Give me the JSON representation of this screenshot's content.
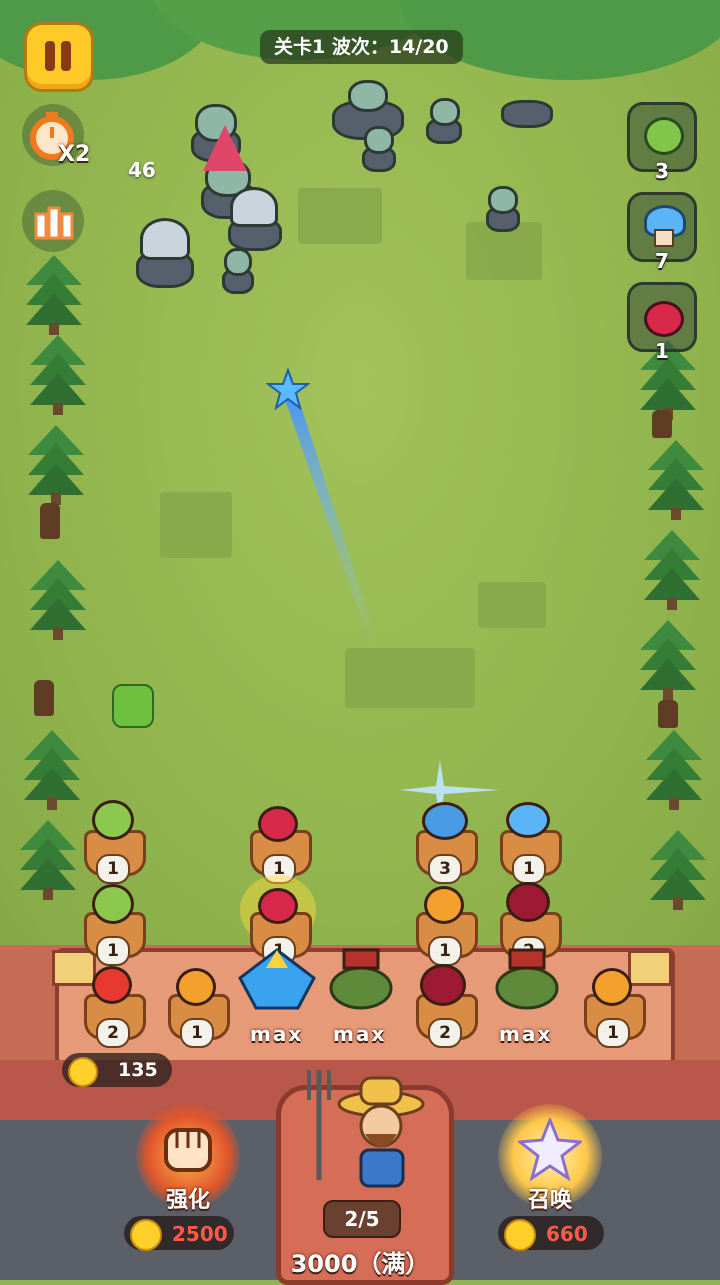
{
  "hud": {
    "level_title": "关卡1 波次：14/20",
    "speed_label": "X2",
    "damage_popup": "46"
  },
  "enemy_queue": [
    {
      "type": "green-peashooter",
      "count": "3"
    },
    {
      "type": "blue-mushroom",
      "count": "7"
    },
    {
      "type": "red-cherry-bomb",
      "count": "1"
    }
  ],
  "plants": [
    {
      "kind": "peashooter",
      "level": "1"
    },
    {
      "kind": "cherry",
      "level": "1"
    },
    {
      "kind": "blue-mushroom",
      "level": "3"
    },
    {
      "kind": "blue-mushroom",
      "level": "1"
    },
    {
      "kind": "peashooter",
      "level": "1"
    },
    {
      "kind": "cherry",
      "level": "1"
    },
    {
      "kind": "sunflower",
      "level": "1"
    },
    {
      "kind": "cherry-dark",
      "level": "2"
    },
    {
      "kind": "red-flower",
      "level": "2"
    },
    {
      "kind": "sunflower",
      "level": "1"
    },
    {
      "kind": "crystal",
      "level": "max"
    },
    {
      "kind": "cowboy-peashooter",
      "level": "max"
    },
    {
      "kind": "cherry-dark",
      "level": "2"
    },
    {
      "kind": "cowboy-peashooter",
      "level": "max"
    },
    {
      "kind": "sunflower",
      "level": "1"
    }
  ],
  "economy": {
    "coins": "135"
  },
  "actions": {
    "upgrade": {
      "label": "强化",
      "cost": "2500"
    },
    "summon": {
      "label": "召唤",
      "cost": "660"
    }
  },
  "farmer": {
    "summon_count": "2/5"
  },
  "base": {
    "hp_text": "3000（满）"
  },
  "colors": {
    "grass": "#93b64f",
    "pause_button": "#ffc928",
    "cost_text": "#ff5a48"
  }
}
